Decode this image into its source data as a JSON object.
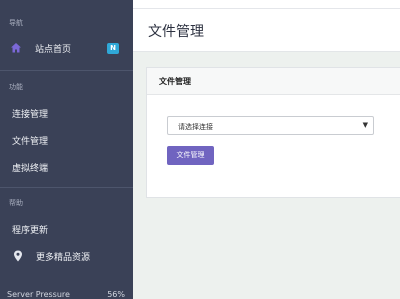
{
  "sidebar": {
    "sections": [
      {
        "label": "导航"
      },
      {
        "label": "功能"
      },
      {
        "label": "帮助"
      }
    ],
    "items": [
      {
        "label": "站点首页",
        "icon": "home-icon",
        "badge": "N",
        "active": true
      },
      {
        "label": "连接管理"
      },
      {
        "label": "文件管理"
      },
      {
        "label": "虚拟终端"
      },
      {
        "label": "程序更新"
      },
      {
        "label": "更多精品资源",
        "icon": "map-pin-icon"
      }
    ],
    "pressure": {
      "label": "Server Pressure",
      "value": "56%"
    }
  },
  "header": {
    "title": "文件管理"
  },
  "panel": {
    "title": "文件管理",
    "select": {
      "selected": "请选择连接"
    },
    "button_label": "文件管理"
  },
  "colors": {
    "sidebar_bg": "#3a4157",
    "accent": "#7064c0",
    "badge": "#2fa8d8",
    "home_icon": "#7b68d8"
  }
}
